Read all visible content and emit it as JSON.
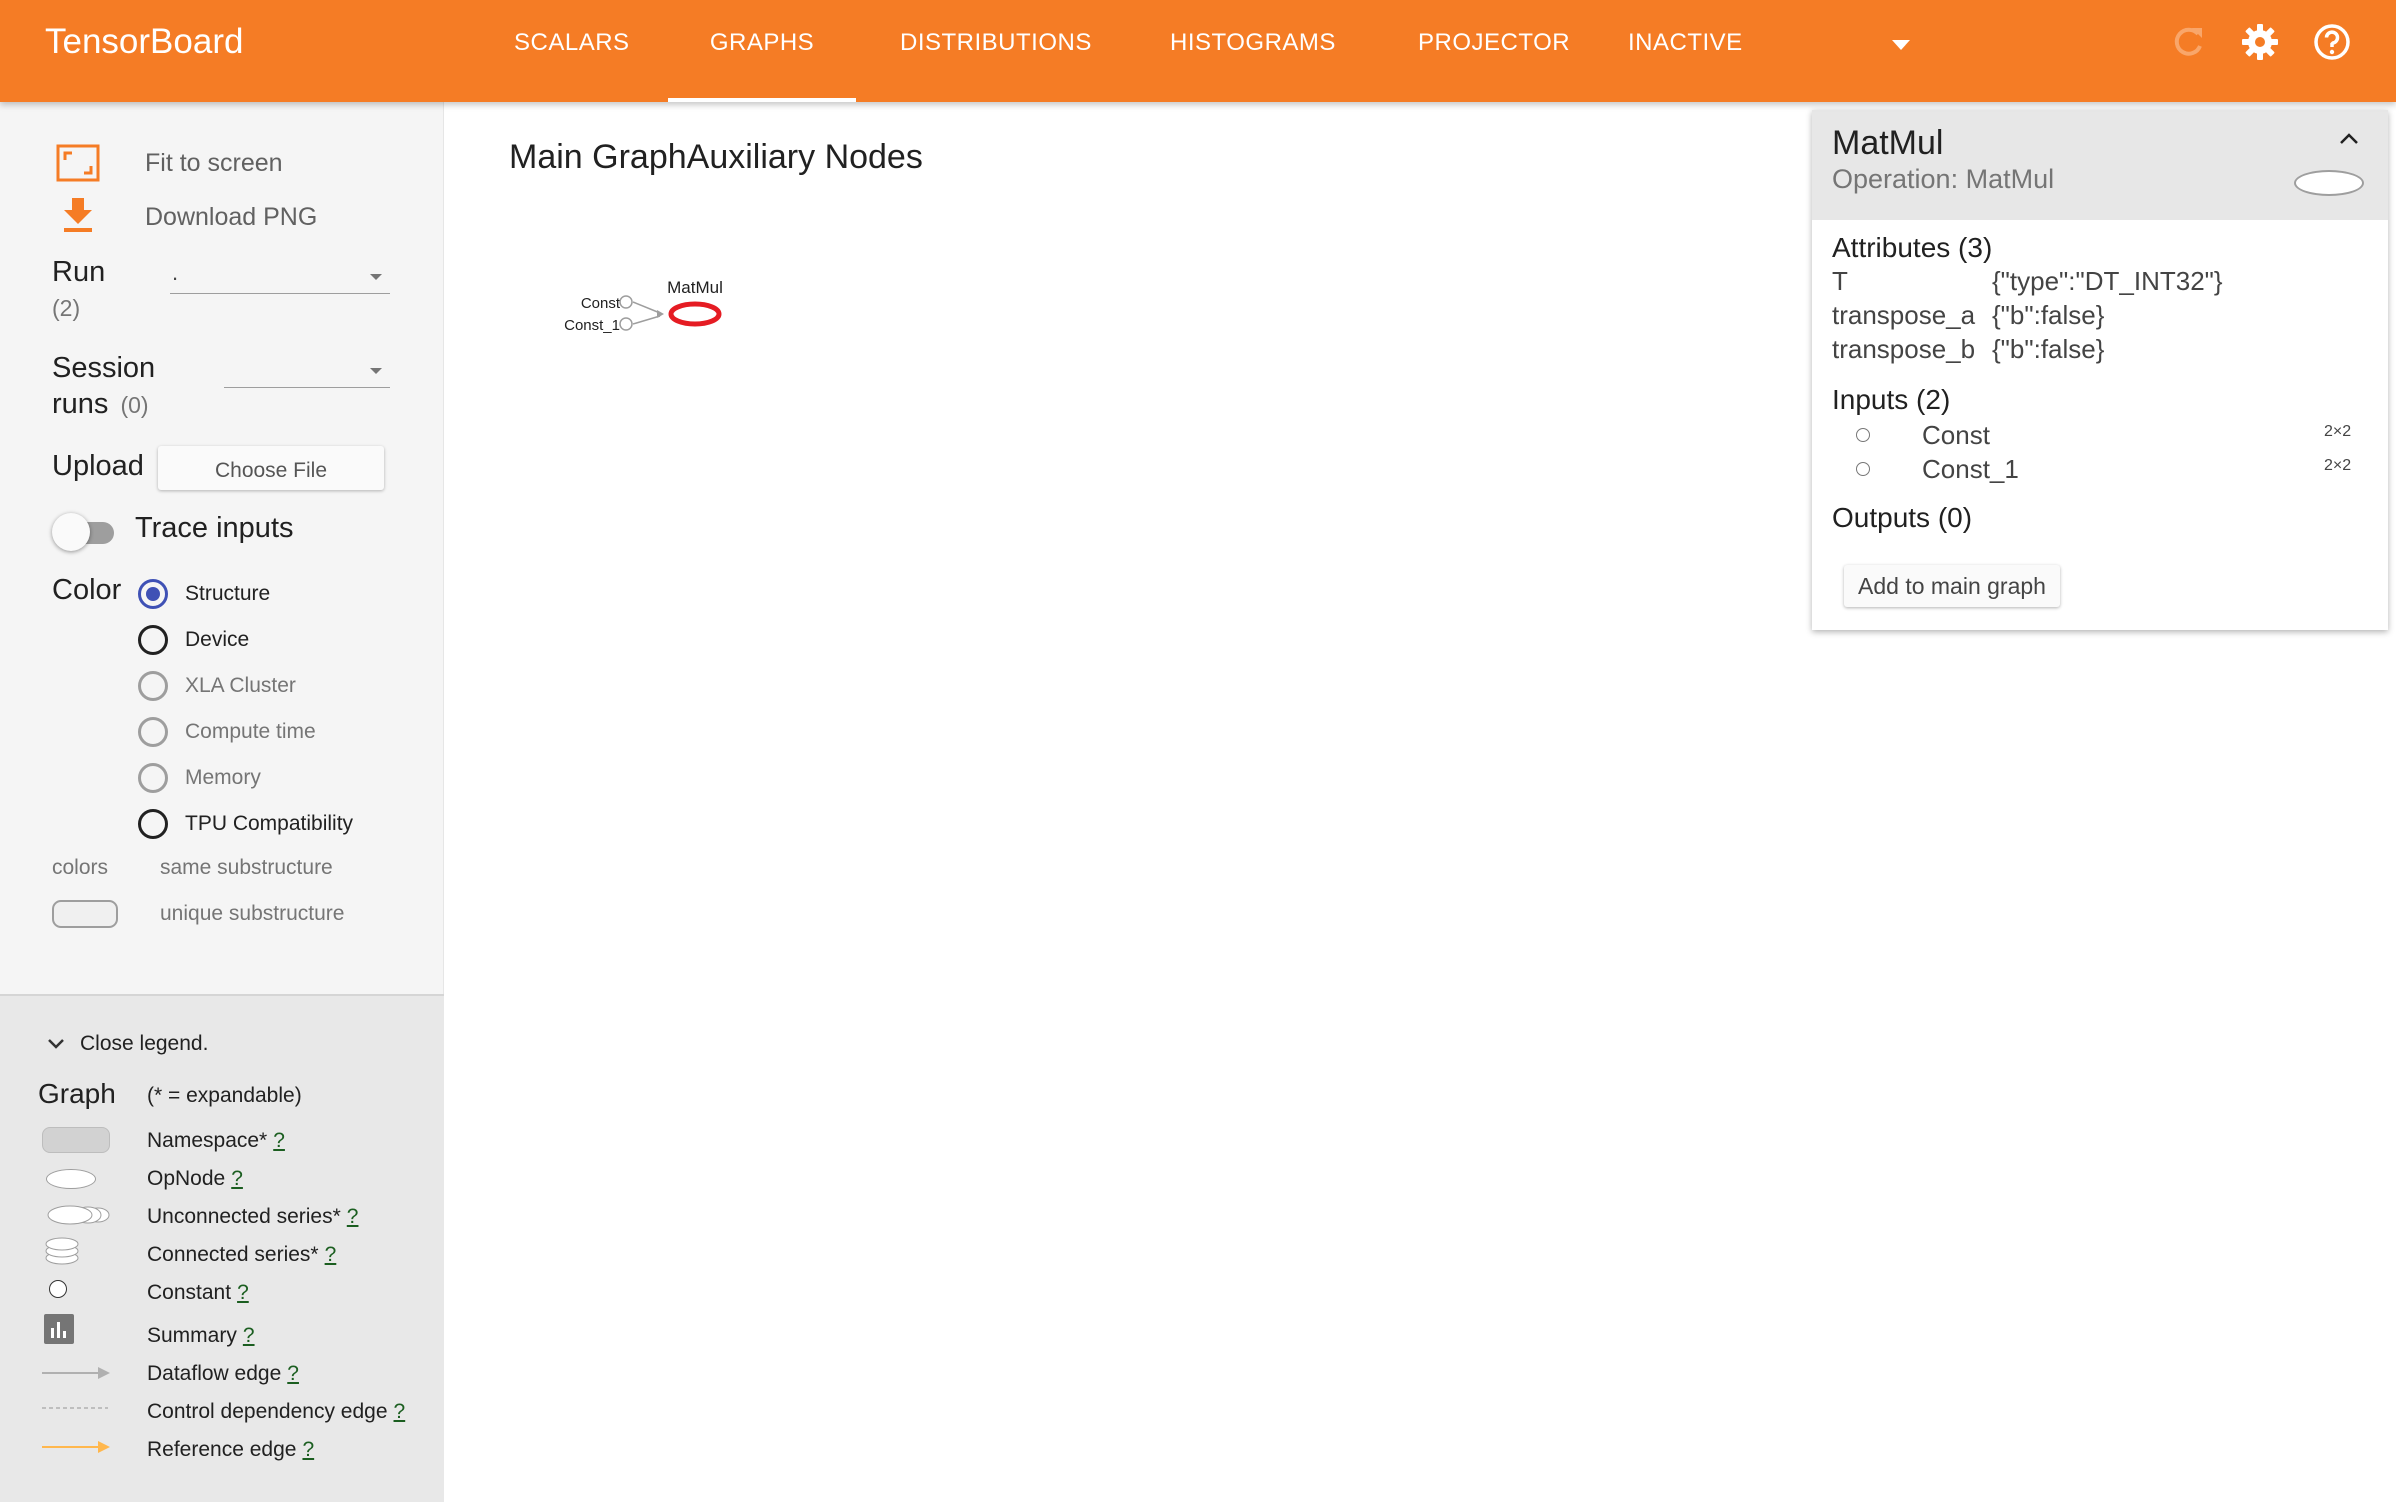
{
  "app": {
    "title": "TensorBoard"
  },
  "nav": {
    "tabs": [
      "SCALARS",
      "GRAPHS",
      "DISTRIBUTIONS",
      "HISTOGRAMS",
      "PROJECTOR",
      "INACTIVE"
    ],
    "active_tab": "GRAPHS",
    "icons": [
      "refresh-icon",
      "settings-gear-icon",
      "help-icon"
    ]
  },
  "sidebar": {
    "fit_to_screen": "Fit to screen",
    "download_png": "Download PNG",
    "run_label": "Run",
    "run_count": "(2)",
    "run_value": ".",
    "session_label_1": "Session",
    "session_label_2": "runs",
    "session_count": "(0)",
    "upload_label": "Upload",
    "choose_file": "Choose File",
    "trace_inputs": "Trace inputs",
    "color_label": "Color",
    "color_options": [
      "Structure",
      "Device",
      "XLA Cluster",
      "Compute time",
      "Memory",
      "TPU Compatibility"
    ],
    "color_selected": "Structure",
    "colors_label": "colors",
    "same_substructure": "same substructure",
    "unique_substructure": "unique substructure"
  },
  "legend": {
    "close": "Close legend.",
    "graph_label": "Graph",
    "expandable_note": "(* = expandable)",
    "items": [
      "Namespace*",
      "OpNode",
      "Unconnected series*",
      "Connected series*",
      "Constant",
      "Summary",
      "Dataflow edge",
      "Control dependency edge",
      "Reference edge"
    ],
    "help_mark": "?"
  },
  "main": {
    "title": "Main GraphAuxiliary Nodes",
    "graph": {
      "nodes": [
        "Const",
        "Const_1",
        "MatMul"
      ],
      "selected_node": "MatMul",
      "selected_color": "#e51c23"
    }
  },
  "card": {
    "title": "MatMul",
    "subtitle": "Operation: MatMul",
    "attributes_header": "Attributes (3)",
    "attributes": [
      {
        "key": "T",
        "value": "{\"type\":\"DT_INT32\"}"
      },
      {
        "key": "transpose_a",
        "value": "{\"b\":false}"
      },
      {
        "key": "transpose_b",
        "value": "{\"b\":false}"
      }
    ],
    "inputs_header": "Inputs (2)",
    "inputs": [
      {
        "name": "Const",
        "shape": "2×2"
      },
      {
        "name": "Const_1",
        "shape": "2×2"
      }
    ],
    "outputs_header": "Outputs (0)",
    "add_button": "Add to main graph"
  },
  "colors": {
    "brand": "#f57c25",
    "radio_selected": "#3f51b5",
    "help_link": "#1b5e20"
  }
}
